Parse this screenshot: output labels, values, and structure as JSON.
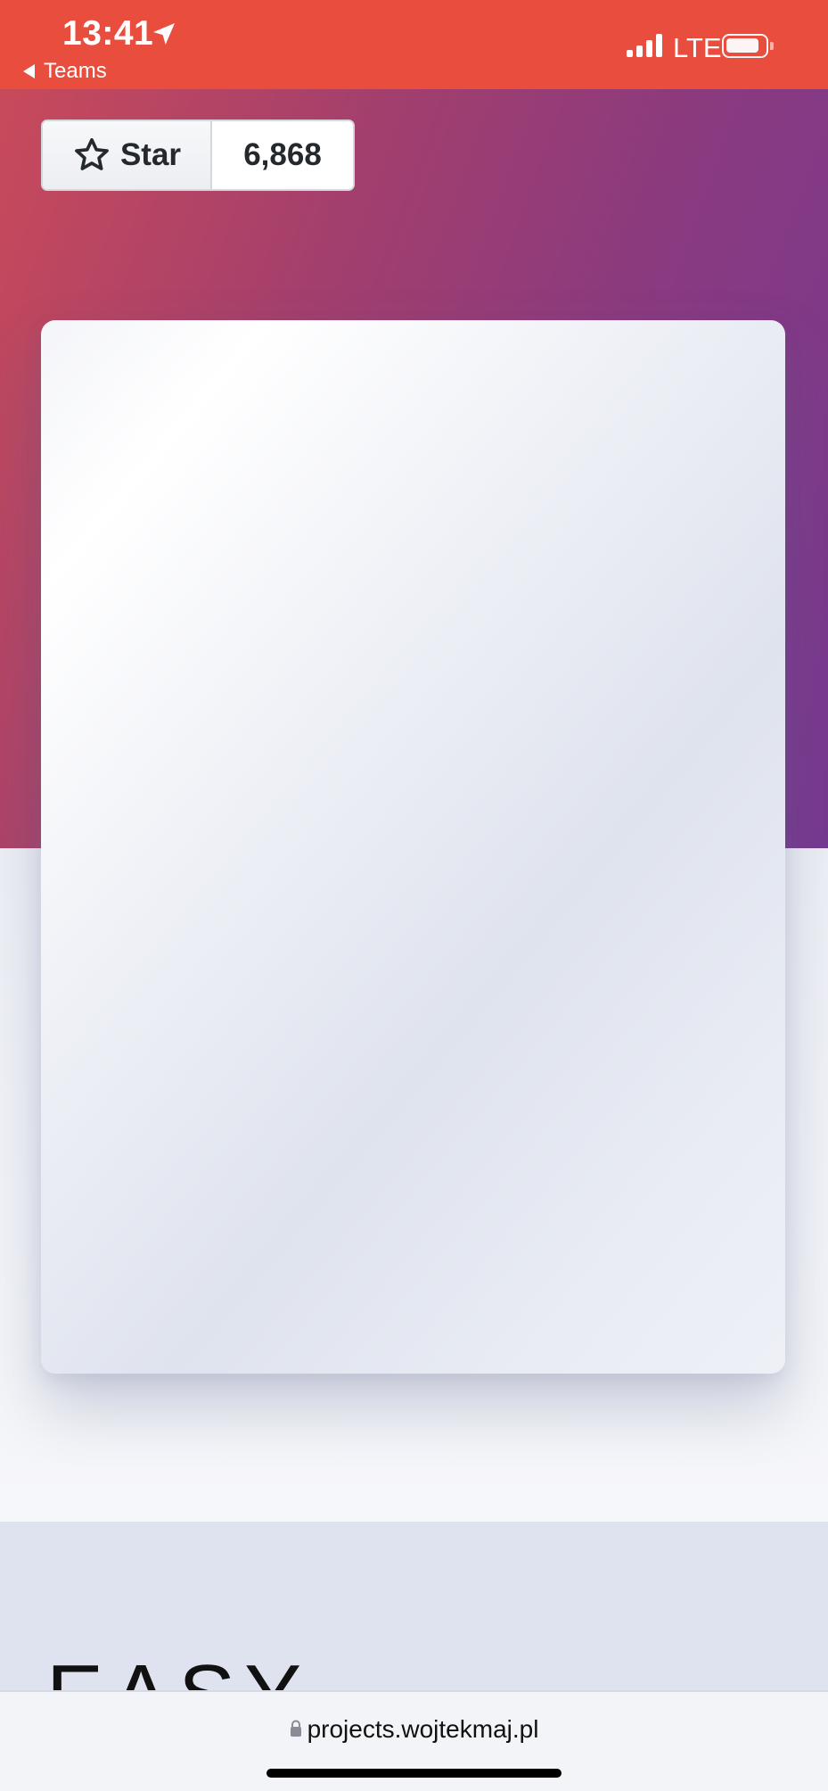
{
  "status_bar": {
    "time": "13:41",
    "back_label": "Teams",
    "network": "LTE",
    "background": "#e84d3d"
  },
  "github_star": {
    "label": "Star",
    "count": "6,868",
    "icon": "star-icon"
  },
  "section": {
    "heading": "EASY"
  },
  "browser": {
    "url": "projects.wojtekmaj.pl",
    "secure_icon": "lock-icon"
  },
  "colors": {
    "hero_gradient_start": "#c84a5a",
    "hero_gradient_end": "#763890",
    "card_background": "#eef0f6"
  }
}
